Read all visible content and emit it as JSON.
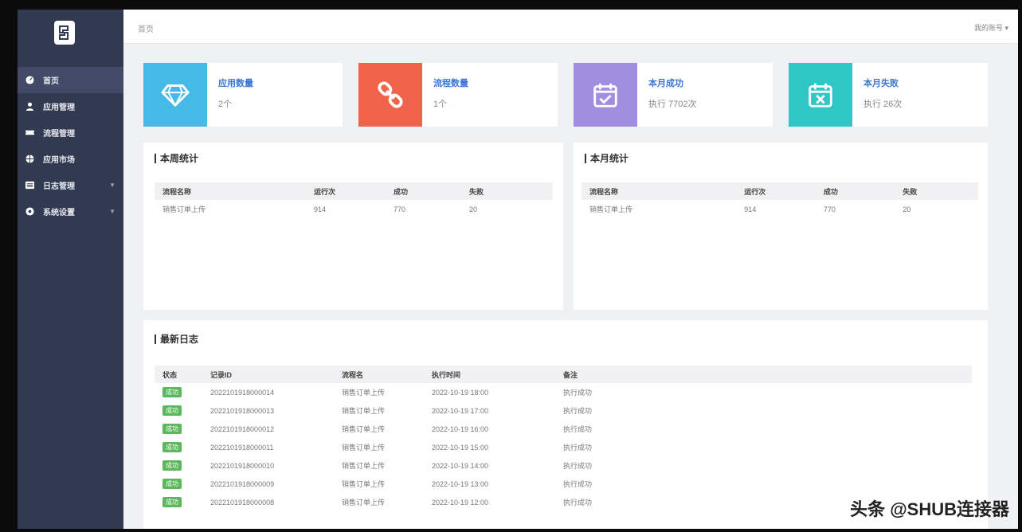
{
  "breadcrumb": "首页",
  "account": "我的账号",
  "sidebar": {
    "items": [
      {
        "label": "首页",
        "icon": "speedometer-icon"
      },
      {
        "label": "应用管理",
        "icon": "user-icon"
      },
      {
        "label": "流程管理",
        "icon": "ticket-icon"
      },
      {
        "label": "应用市场",
        "icon": "globe-icon"
      },
      {
        "label": "日志管理",
        "icon": "list-icon"
      },
      {
        "label": "系统设置",
        "icon": "gear-icon"
      }
    ]
  },
  "stats": [
    {
      "title": "应用数量",
      "value": "2个",
      "color": "#47b9e8",
      "icon": "diamond-icon"
    },
    {
      "title": "流程数量",
      "value": "1个",
      "color": "#f0634a",
      "icon": "link-icon"
    },
    {
      "title": "本月成功",
      "value": "执行 7702次",
      "color": "#a38de0",
      "icon": "calendar-check-icon"
    },
    {
      "title": "本月失败",
      "value": "执行 26次",
      "color": "#2fc7c5",
      "icon": "calendar-x-icon"
    }
  ],
  "panels": [
    {
      "title": "本周统计",
      "headers": [
        "流程名称",
        "运行次",
        "成功",
        "失败"
      ],
      "rows": [
        [
          "销售订单上传",
          "914",
          "770",
          "20"
        ]
      ]
    },
    {
      "title": "本月统计",
      "headers": [
        "流程名称",
        "运行次",
        "成功",
        "失败"
      ],
      "rows": [
        [
          "销售订单上传",
          "914",
          "770",
          "20"
        ]
      ]
    }
  ],
  "logs": {
    "title": "最新日志",
    "headers": [
      "状态",
      "记录ID",
      "流程名",
      "执行时间",
      "备注"
    ],
    "rows": [
      {
        "status": "成功",
        "id": "2022101918000014",
        "flow": "销售订单上传",
        "time": "2022-10-19 18:00",
        "note": "执行成功"
      },
      {
        "status": "成功",
        "id": "2022101918000013",
        "flow": "销售订单上传",
        "time": "2022-10-19 17:00",
        "note": "执行成功"
      },
      {
        "status": "成功",
        "id": "2022101918000012",
        "flow": "销售订单上传",
        "time": "2022-10-19 16:00",
        "note": "执行成功"
      },
      {
        "status": "成功",
        "id": "2022101918000011",
        "flow": "销售订单上传",
        "time": "2022-10-19 15:00",
        "note": "执行成功"
      },
      {
        "status": "成功",
        "id": "2022101918000010",
        "flow": "销售订单上传",
        "time": "2022-10-19 14:00",
        "note": "执行成功"
      },
      {
        "status": "成功",
        "id": "2022101918000009",
        "flow": "销售订单上传",
        "time": "2022-10-19 13:00",
        "note": "执行成功"
      },
      {
        "status": "成功",
        "id": "2022101918000008",
        "flow": "销售订单上传",
        "time": "2022-10-19 12:00",
        "note": "执行成功"
      }
    ]
  },
  "watermark": "头条 @SHUB连接器"
}
